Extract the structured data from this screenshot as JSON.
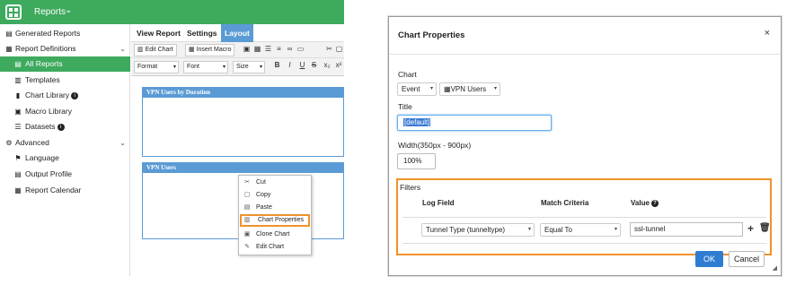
{
  "left_app": {
    "title": "Reports",
    "sidebar": [
      {
        "label": "Generated Reports",
        "icon": "generated-reports-icon"
      },
      {
        "label": "Report Definitions",
        "icon": "report-definitions-icon"
      },
      {
        "label": "All Reports",
        "icon": "all-reports-icon",
        "active": true
      },
      {
        "label": "Templates",
        "icon": "templates-icon"
      },
      {
        "label": "Chart Library",
        "icon": "chart-library-icon"
      },
      {
        "label": "Macro Library",
        "icon": "macro-library-icon"
      },
      {
        "label": "Datasets",
        "icon": "datasets-icon"
      },
      {
        "label": "Advanced",
        "icon": "advanced-gear-icon"
      },
      {
        "label": "Language",
        "icon": "language-icon"
      },
      {
        "label": "Output Profile",
        "icon": "output-profile-icon"
      },
      {
        "label": "Report Calendar",
        "icon": "report-calendar-icon"
      }
    ],
    "tabs": [
      "View Report",
      "Settings",
      "Layout"
    ],
    "toolbar": {
      "edit_chart": "Edit Chart",
      "insert_macro": "Insert Macro",
      "format": "Format",
      "font": "Font",
      "size": "Size",
      "bold": "B",
      "italic": "I",
      "underline": "U",
      "strike": "S",
      "subscript": "x₂",
      "superscript": "x²"
    },
    "charts": [
      "VPN Users by Duration",
      "VPN Users"
    ],
    "context_menu": [
      "Cut",
      "Copy",
      "Paste",
      "Chart Properties",
      "Clone Chart",
      "Edit Chart"
    ]
  },
  "dialog": {
    "title": "Chart Properties",
    "close": "×",
    "chart_label": "Chart",
    "chart_source": "Event",
    "chart_name": "VPN Users",
    "title_label": "Title",
    "title_value": "[default]",
    "width_label": "Width(350px - 900px)",
    "width_value": "100%",
    "filters_label": "Filters",
    "col_log_field": "Log Field",
    "col_match": "Match Criteria",
    "col_value": "Value",
    "filter_field": "Tunnel Type (tunneltype)",
    "filter_match": "Equal To",
    "filter_value": "ssl-tunnel",
    "ok": "OK",
    "cancel": "Cancel"
  },
  "colors": {
    "brand_green": "#3eaa5e",
    "accent_blue": "#5b9bd5",
    "highlight_orange": "#f0922a",
    "ok_blue": "#2e7dd1"
  }
}
